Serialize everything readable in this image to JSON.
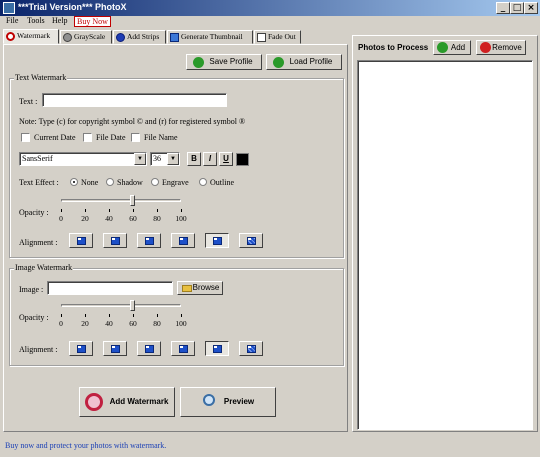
{
  "window": {
    "title": "***Trial Version*** PhotoX",
    "controls": {
      "minimize": "_",
      "maximize": "□",
      "close": "×"
    }
  },
  "menu": {
    "file": "File",
    "tools": "Tools",
    "help": "Help",
    "buy": "Buy Now"
  },
  "tabs": [
    {
      "label": "Watermark",
      "icon": "watermark-icon"
    },
    {
      "label": "GrayScale",
      "icon": "grayscale-icon"
    },
    {
      "label": "Add Strips",
      "icon": "strips-icon"
    },
    {
      "label": "Generate Thumbnail",
      "icon": "thumbnail-icon"
    },
    {
      "label": "Fade Out",
      "icon": "fade-icon"
    }
  ],
  "profile": {
    "save": "Save Profile",
    "load": "Load Profile"
  },
  "text_watermark": {
    "group_label": "Text Watermark",
    "text_label": "Text :",
    "text_value": "",
    "note": "Note: Type (c) for copyright symbol © and (r) for registered symbol ®",
    "checks": [
      "Current Date",
      "File Date",
      "File Name"
    ],
    "font": "SansSerif",
    "size": "36",
    "bold": "B",
    "italic": "I",
    "underline": "U",
    "color": "#000000",
    "effect_label": "Text Effect :",
    "effects": [
      "None",
      "Shadow",
      "Engrave",
      "Outline"
    ],
    "effect_selected": "None",
    "opacity_label": "Opacity :",
    "opacity_ticks": [
      "0",
      "20",
      "40",
      "60",
      "80",
      "100"
    ],
    "opacity_value": 60,
    "alignment_label": "Alignment :",
    "alignment_selected": 5
  },
  "image_watermark": {
    "group_label": "Image Watermark",
    "image_label": "Image :",
    "image_value": "",
    "browse": "Browse",
    "opacity_label": "Opacity :",
    "opacity_ticks": [
      "0",
      "20",
      "40",
      "60",
      "80",
      "100"
    ],
    "opacity_value": 60,
    "alignment_label": "Alignment :",
    "alignment_selected": 5
  },
  "actions": {
    "add_watermark": "Add Watermark",
    "preview": "Preview"
  },
  "right": {
    "title": "Photos to Process",
    "add": "Add",
    "remove": "Remove"
  },
  "status": "Buy now and protect your photos with watermark."
}
